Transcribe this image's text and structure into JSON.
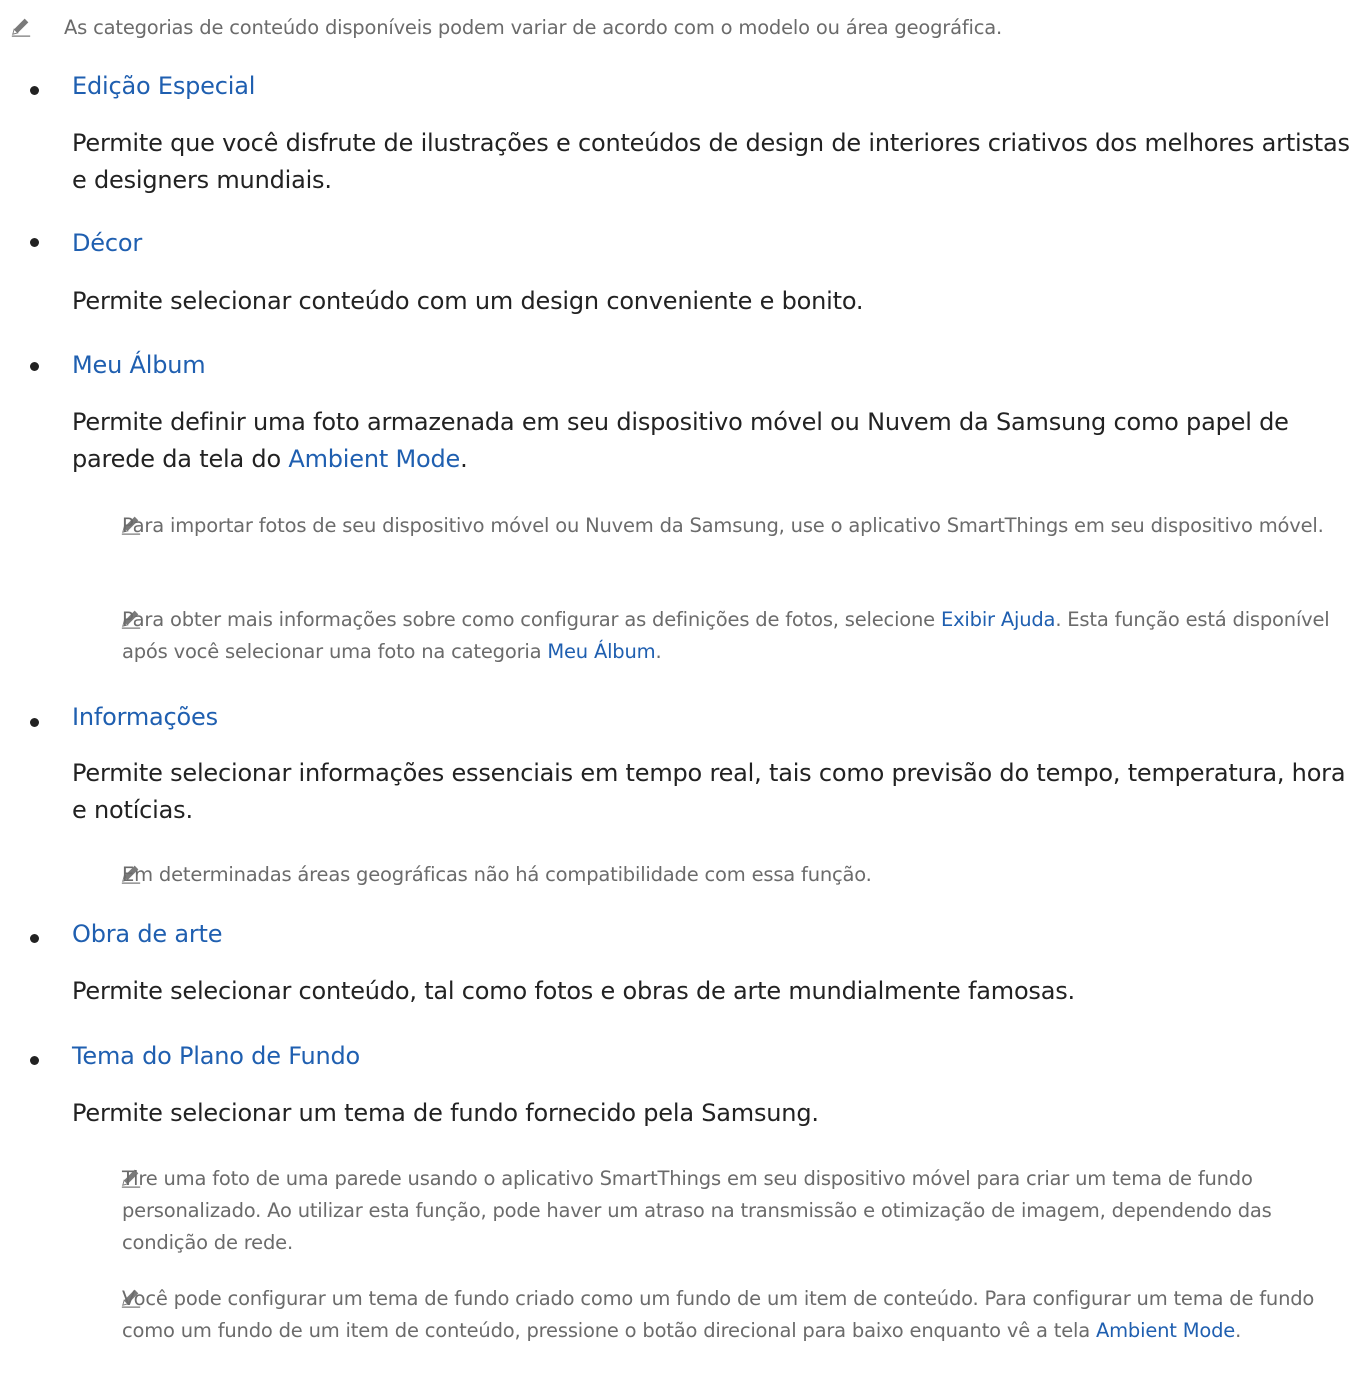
{
  "top_note": "As categorias de conteúdo disponíveis podem variar de acordo com o modelo ou área geográfica.",
  "sections": [
    {
      "title": "Edição Especial",
      "desc": "Permite que você disfrute de ilustrações e conteúdos de design de interiores criativos dos melhores artistas e designers mundiais."
    },
    {
      "title": "Décor",
      "desc": "Permite selecionar conteúdo com um design conveniente e bonito."
    },
    {
      "title": "Meu Álbum",
      "desc_pre": "Permite definir uma foto armazenada em seu dispositivo móvel ou Nuvem da Samsung como papel de parede da tela do ",
      "desc_link": "Ambient Mode",
      "desc_post": ".",
      "notes": [
        {
          "text": "Para importar fotos de seu dispositivo móvel ou Nuvem da Samsung, use o aplicativo SmartThings em seu dispositivo móvel."
        },
        {
          "pre": "Para obter mais informações sobre como configurar as definições de fotos, selecione ",
          "link1": "Exibir Ajuda",
          "mid": ". Esta função está disponível após você selecionar uma foto na categoria ",
          "link2": "Meu Álbum",
          "post": "."
        }
      ]
    },
    {
      "title": "Informações",
      "desc": "Permite selecionar informações essenciais em tempo real, tais como previsão do tempo, temperatura, hora e notícias.",
      "notes": [
        {
          "text": "Em determinadas áreas geográficas não há compatibilidade com essa função."
        }
      ]
    },
    {
      "title": "Obra de arte",
      "desc": "Permite selecionar conteúdo, tal como fotos e obras de arte mundialmente famosas."
    },
    {
      "title": "Tema do Plano de Fundo",
      "desc": "Permite selecionar um tema de fundo fornecido pela Samsung.",
      "notes": [
        {
          "text": "Tire uma foto de uma parede usando o aplicativo SmartThings em seu dispositivo móvel para criar um tema de fundo personalizado. Ao utilizar esta função, pode haver um atraso na transmissão e otimização de imagem, dependendo das condição de rede."
        },
        {
          "pre": "Você pode configurar um tema de fundo criado como um fundo de um item de conteúdo. Para configurar um tema de fundo como um fundo de um item de conteúdo, pressione o botão direcional para baixo enquanto vê a tela ",
          "link1": "Ambient Mode",
          "post": "."
        }
      ]
    }
  ],
  "colors": {
    "link": "#1f5fb0",
    "note_text": "#6b6b6b",
    "body_text": "#222222"
  },
  "icons": {
    "note": "pencil-icon",
    "bullet": "bullet-dot"
  }
}
